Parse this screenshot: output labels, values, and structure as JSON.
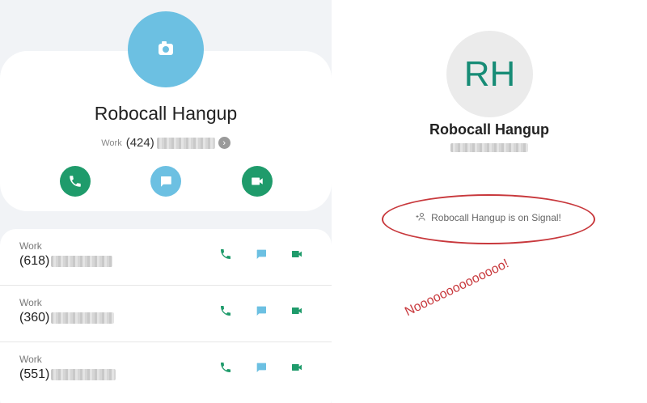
{
  "contact_card": {
    "name": "Robocall Hangup",
    "primary_phone": {
      "label": "Work",
      "prefix": "(424)"
    },
    "actions": [
      "call",
      "message",
      "video"
    ],
    "avatar_icon": "camera-icon",
    "accent_green": "#1f9b6b",
    "accent_blue": "#6cc0e2"
  },
  "numbers": [
    {
      "label": "Work",
      "prefix": "(618)"
    },
    {
      "label": "Work",
      "prefix": "(360)"
    },
    {
      "label": "Work",
      "prefix": "(551)"
    }
  ],
  "signal": {
    "initials": "RH",
    "name": "Robocall Hangup",
    "notice": "Robocall Hangup is on Signal!",
    "notice_icon": "add-person-icon"
  },
  "annotation": {
    "text": "Noooooooooooooo!",
    "color": "#c8383c"
  }
}
